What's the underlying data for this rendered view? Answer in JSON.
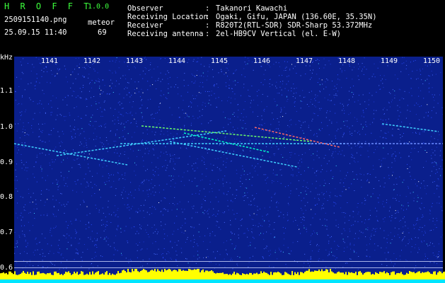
{
  "header": {
    "logo": "H R O F F T",
    "version": "1.0.0",
    "filename": "2509151140.png",
    "mode_label": "meteor",
    "datetime": "25.09.15 11:40",
    "count": "69",
    "meta": [
      {
        "label": "Observer",
        "value": "Takanori Kawachi"
      },
      {
        "label": "Receiving Location",
        "value": "Ogaki, Gifu, JAPAN (136.60E, 35.35N)"
      },
      {
        "label": "Receiver",
        "value": "R820T2(RTL-SDR) SDR-Sharp 53.372MHz"
      },
      {
        "label": "Receiving antenna",
        "value": "2el-HB9CV Vertical (el. E-W)"
      }
    ]
  },
  "axis": {
    "y_unit": "kHz",
    "x_ticks": [
      "1141",
      "1142",
      "1143",
      "1144",
      "1145",
      "1146",
      "1147",
      "1148",
      "1149",
      "1150"
    ],
    "y_ticks": [
      "1.1",
      "1.0",
      "0.9",
      "0.8",
      "0.7",
      "0.6"
    ]
  },
  "colors": {
    "background": "#0a1f8c",
    "header_green": "#3cff3c",
    "audio_yellow": "#ffff00",
    "audio_cyan": "#00e5ff"
  }
}
